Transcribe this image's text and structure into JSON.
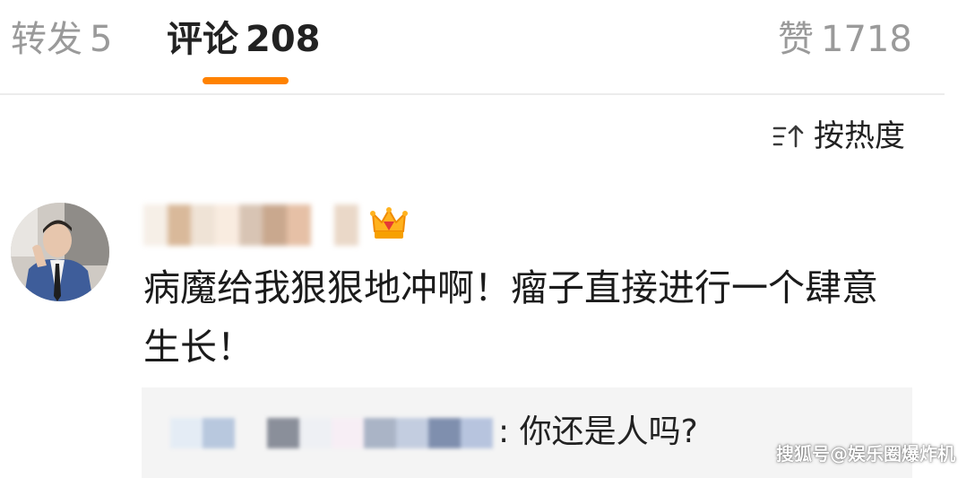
{
  "tabs": {
    "repost": {
      "label": "转发",
      "count": "5"
    },
    "comment": {
      "label": "评论",
      "count": "208"
    },
    "like": {
      "label": "赞",
      "count": "1718"
    }
  },
  "accent_color": "#ff8200",
  "sort": {
    "label": "按热度",
    "icon": "sort-arrow-icon"
  },
  "comment": {
    "avatar": "avatar",
    "badge_icon": "crown-vip-icon",
    "text": "病魔给我狠狠地冲啊！瘤子直接进行一个肆意生长！",
    "reply": {
      "text": ": 你还是人吗?"
    }
  },
  "watermark": "搜狐号@娱乐圈爆炸机"
}
